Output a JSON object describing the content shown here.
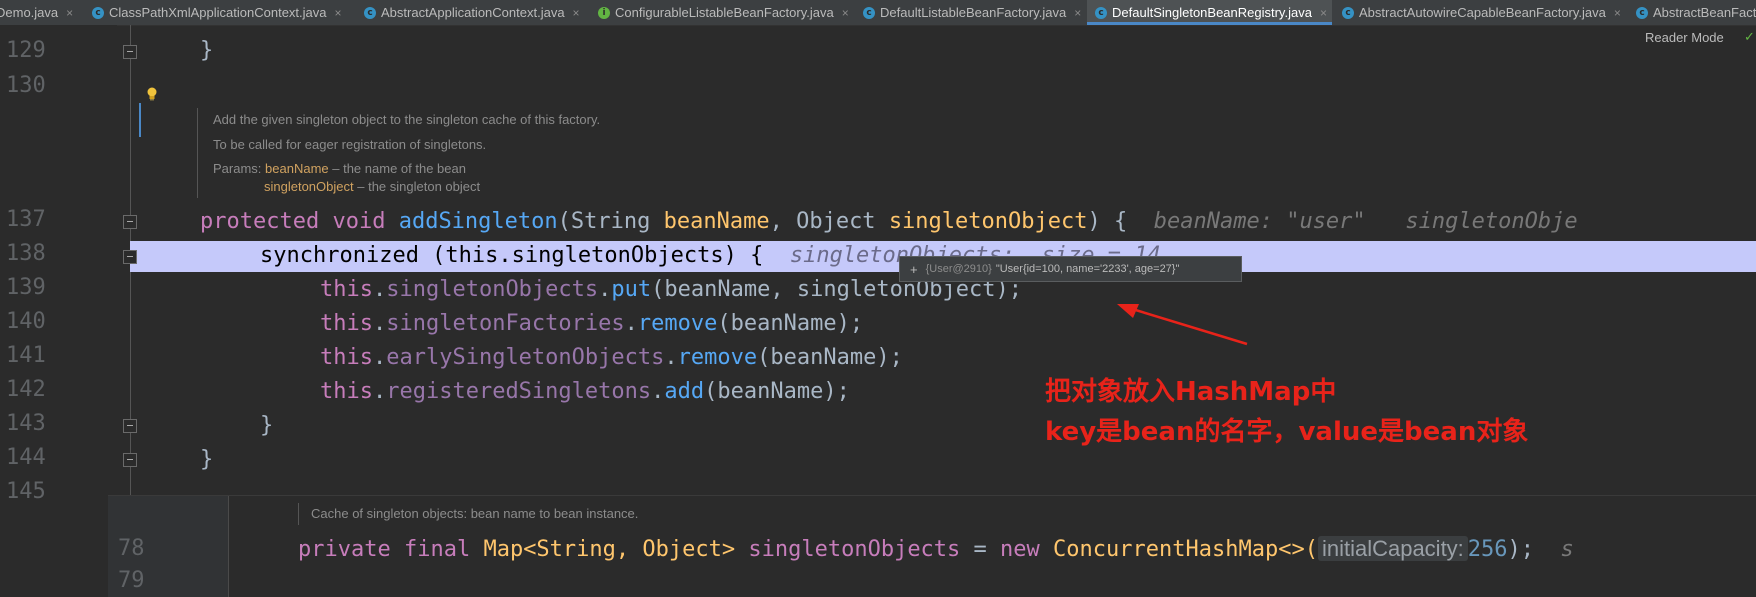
{
  "tabs": [
    {
      "label": "Demo.java",
      "active": false,
      "icon": "none"
    },
    {
      "label": "ClassPathXmlApplicationContext.java",
      "active": false,
      "icon": "class-icon"
    },
    {
      "label": "AbstractApplicationContext.java",
      "active": false,
      "icon": "class-icon"
    },
    {
      "label": "ConfigurableListableBeanFactory.java",
      "active": false,
      "icon": "interface-icon"
    },
    {
      "label": "DefaultListableBeanFactory.java",
      "active": false,
      "icon": "class-icon"
    },
    {
      "label": "DefaultSingletonBeanRegistry.java",
      "active": true,
      "icon": "class-icon"
    },
    {
      "label": "AbstractAutowireCapableBeanFactory.java",
      "active": false,
      "icon": "class-icon"
    },
    {
      "label": "AbstractBeanFact",
      "active": false,
      "icon": "class-icon"
    }
  ],
  "tab_close_glyph": "×",
  "reader_mode": {
    "label": "Reader Mode",
    "check_glyph": "✓"
  },
  "line_numbers": [
    "129",
    "130",
    "137",
    "138",
    "139",
    "140",
    "141",
    "142",
    "143",
    "144",
    "145"
  ],
  "javadoc": {
    "line1": "Add the given singleton object to the singleton cache of this factory.",
    "line2": "To be called for eager registration of singletons.",
    "params_label": "Params:",
    "param1_name": "beanName",
    "param1_desc": " – the name of the bean",
    "param2_name": "singletonObject",
    "param2_desc": " – the singleton object"
  },
  "code": {
    "l129": "}",
    "l137_kw1": "protected",
    "l137_kw2": "void",
    "l137_method": "addSingleton",
    "l137_params_a": "(String ",
    "l137_p1": "beanName",
    "l137_params_b": ", Object ",
    "l137_p2": "singletonObject",
    "l137_params_c": ") {",
    "l137_hint": "beanName: \"user\"   singletonObje",
    "l138_text": "synchronized (this.singletonObjects) {",
    "l138_hint": "singletonObjects:  size = 14",
    "l139_this": "this",
    "l139_field": "singletonObjects",
    "l139_method": "put",
    "l139_args": "(beanName, singletonObject);",
    "l140_this": "this",
    "l140_field": "singletonFactories",
    "l140_method": "remove",
    "l140_args": "(beanName);",
    "l141_this": "this",
    "l141_field": "earlySingletonObjects",
    "l141_method": "remove",
    "l141_args": "(beanName);",
    "l142_this": "this",
    "l142_field": "registeredSingletons",
    "l142_method": "add",
    "l142_args": "(beanName);",
    "l143": "}",
    "l144": "}"
  },
  "tooltip": {
    "plus": "+",
    "ref": "{User@2910}",
    "value": "\"User{id=100, name='2233', age=27}\""
  },
  "annotation": {
    "line1": "把对象放入HashMap中",
    "line2": "key是bean的名字，value是bean对象",
    "color": "#e8231a"
  },
  "popup": {
    "doc": "Cache of singleton objects: bean name to bean instance.",
    "ln78": "78",
    "ln79": "79",
    "kw1": "private",
    "kw2": "final",
    "type": "Map<String, Object>",
    "field": "singletonObjects",
    "eq": " = ",
    "kw_new": "new",
    "ctor": "ConcurrentHashMap<>(",
    "inlay": "initialCapacity:",
    "num": "256",
    "end": ");",
    "trail": "s"
  },
  "colors": {
    "background": "#2b2b2b",
    "highlight_line": "#c5c9fa",
    "active_tab_underline": "#4a88c7"
  }
}
